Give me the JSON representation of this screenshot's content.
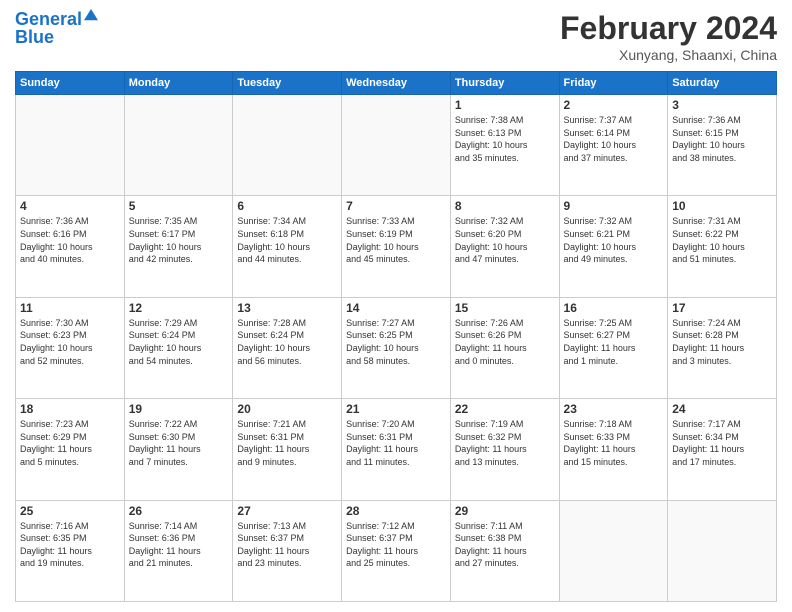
{
  "header": {
    "logo_line1": "General",
    "logo_line2": "Blue",
    "main_title": "February 2024",
    "sub_title": "Xunyang, Shaanxi, China"
  },
  "days_of_week": [
    "Sunday",
    "Monday",
    "Tuesday",
    "Wednesday",
    "Thursday",
    "Friday",
    "Saturday"
  ],
  "weeks": [
    [
      {
        "day": "",
        "info": ""
      },
      {
        "day": "",
        "info": ""
      },
      {
        "day": "",
        "info": ""
      },
      {
        "day": "",
        "info": ""
      },
      {
        "day": "1",
        "info": "Sunrise: 7:38 AM\nSunset: 6:13 PM\nDaylight: 10 hours\nand 35 minutes."
      },
      {
        "day": "2",
        "info": "Sunrise: 7:37 AM\nSunset: 6:14 PM\nDaylight: 10 hours\nand 37 minutes."
      },
      {
        "day": "3",
        "info": "Sunrise: 7:36 AM\nSunset: 6:15 PM\nDaylight: 10 hours\nand 38 minutes."
      }
    ],
    [
      {
        "day": "4",
        "info": "Sunrise: 7:36 AM\nSunset: 6:16 PM\nDaylight: 10 hours\nand 40 minutes."
      },
      {
        "day": "5",
        "info": "Sunrise: 7:35 AM\nSunset: 6:17 PM\nDaylight: 10 hours\nand 42 minutes."
      },
      {
        "day": "6",
        "info": "Sunrise: 7:34 AM\nSunset: 6:18 PM\nDaylight: 10 hours\nand 44 minutes."
      },
      {
        "day": "7",
        "info": "Sunrise: 7:33 AM\nSunset: 6:19 PM\nDaylight: 10 hours\nand 45 minutes."
      },
      {
        "day": "8",
        "info": "Sunrise: 7:32 AM\nSunset: 6:20 PM\nDaylight: 10 hours\nand 47 minutes."
      },
      {
        "day": "9",
        "info": "Sunrise: 7:32 AM\nSunset: 6:21 PM\nDaylight: 10 hours\nand 49 minutes."
      },
      {
        "day": "10",
        "info": "Sunrise: 7:31 AM\nSunset: 6:22 PM\nDaylight: 10 hours\nand 51 minutes."
      }
    ],
    [
      {
        "day": "11",
        "info": "Sunrise: 7:30 AM\nSunset: 6:23 PM\nDaylight: 10 hours\nand 52 minutes."
      },
      {
        "day": "12",
        "info": "Sunrise: 7:29 AM\nSunset: 6:24 PM\nDaylight: 10 hours\nand 54 minutes."
      },
      {
        "day": "13",
        "info": "Sunrise: 7:28 AM\nSunset: 6:24 PM\nDaylight: 10 hours\nand 56 minutes."
      },
      {
        "day": "14",
        "info": "Sunrise: 7:27 AM\nSunset: 6:25 PM\nDaylight: 10 hours\nand 58 minutes."
      },
      {
        "day": "15",
        "info": "Sunrise: 7:26 AM\nSunset: 6:26 PM\nDaylight: 11 hours\nand 0 minutes."
      },
      {
        "day": "16",
        "info": "Sunrise: 7:25 AM\nSunset: 6:27 PM\nDaylight: 11 hours\nand 1 minute."
      },
      {
        "day": "17",
        "info": "Sunrise: 7:24 AM\nSunset: 6:28 PM\nDaylight: 11 hours\nand 3 minutes."
      }
    ],
    [
      {
        "day": "18",
        "info": "Sunrise: 7:23 AM\nSunset: 6:29 PM\nDaylight: 11 hours\nand 5 minutes."
      },
      {
        "day": "19",
        "info": "Sunrise: 7:22 AM\nSunset: 6:30 PM\nDaylight: 11 hours\nand 7 minutes."
      },
      {
        "day": "20",
        "info": "Sunrise: 7:21 AM\nSunset: 6:31 PM\nDaylight: 11 hours\nand 9 minutes."
      },
      {
        "day": "21",
        "info": "Sunrise: 7:20 AM\nSunset: 6:31 PM\nDaylight: 11 hours\nand 11 minutes."
      },
      {
        "day": "22",
        "info": "Sunrise: 7:19 AM\nSunset: 6:32 PM\nDaylight: 11 hours\nand 13 minutes."
      },
      {
        "day": "23",
        "info": "Sunrise: 7:18 AM\nSunset: 6:33 PM\nDaylight: 11 hours\nand 15 minutes."
      },
      {
        "day": "24",
        "info": "Sunrise: 7:17 AM\nSunset: 6:34 PM\nDaylight: 11 hours\nand 17 minutes."
      }
    ],
    [
      {
        "day": "25",
        "info": "Sunrise: 7:16 AM\nSunset: 6:35 PM\nDaylight: 11 hours\nand 19 minutes."
      },
      {
        "day": "26",
        "info": "Sunrise: 7:14 AM\nSunset: 6:36 PM\nDaylight: 11 hours\nand 21 minutes."
      },
      {
        "day": "27",
        "info": "Sunrise: 7:13 AM\nSunset: 6:37 PM\nDaylight: 11 hours\nand 23 minutes."
      },
      {
        "day": "28",
        "info": "Sunrise: 7:12 AM\nSunset: 6:37 PM\nDaylight: 11 hours\nand 25 minutes."
      },
      {
        "day": "29",
        "info": "Sunrise: 7:11 AM\nSunset: 6:38 PM\nDaylight: 11 hours\nand 27 minutes."
      },
      {
        "day": "",
        "info": ""
      },
      {
        "day": "",
        "info": ""
      }
    ]
  ]
}
